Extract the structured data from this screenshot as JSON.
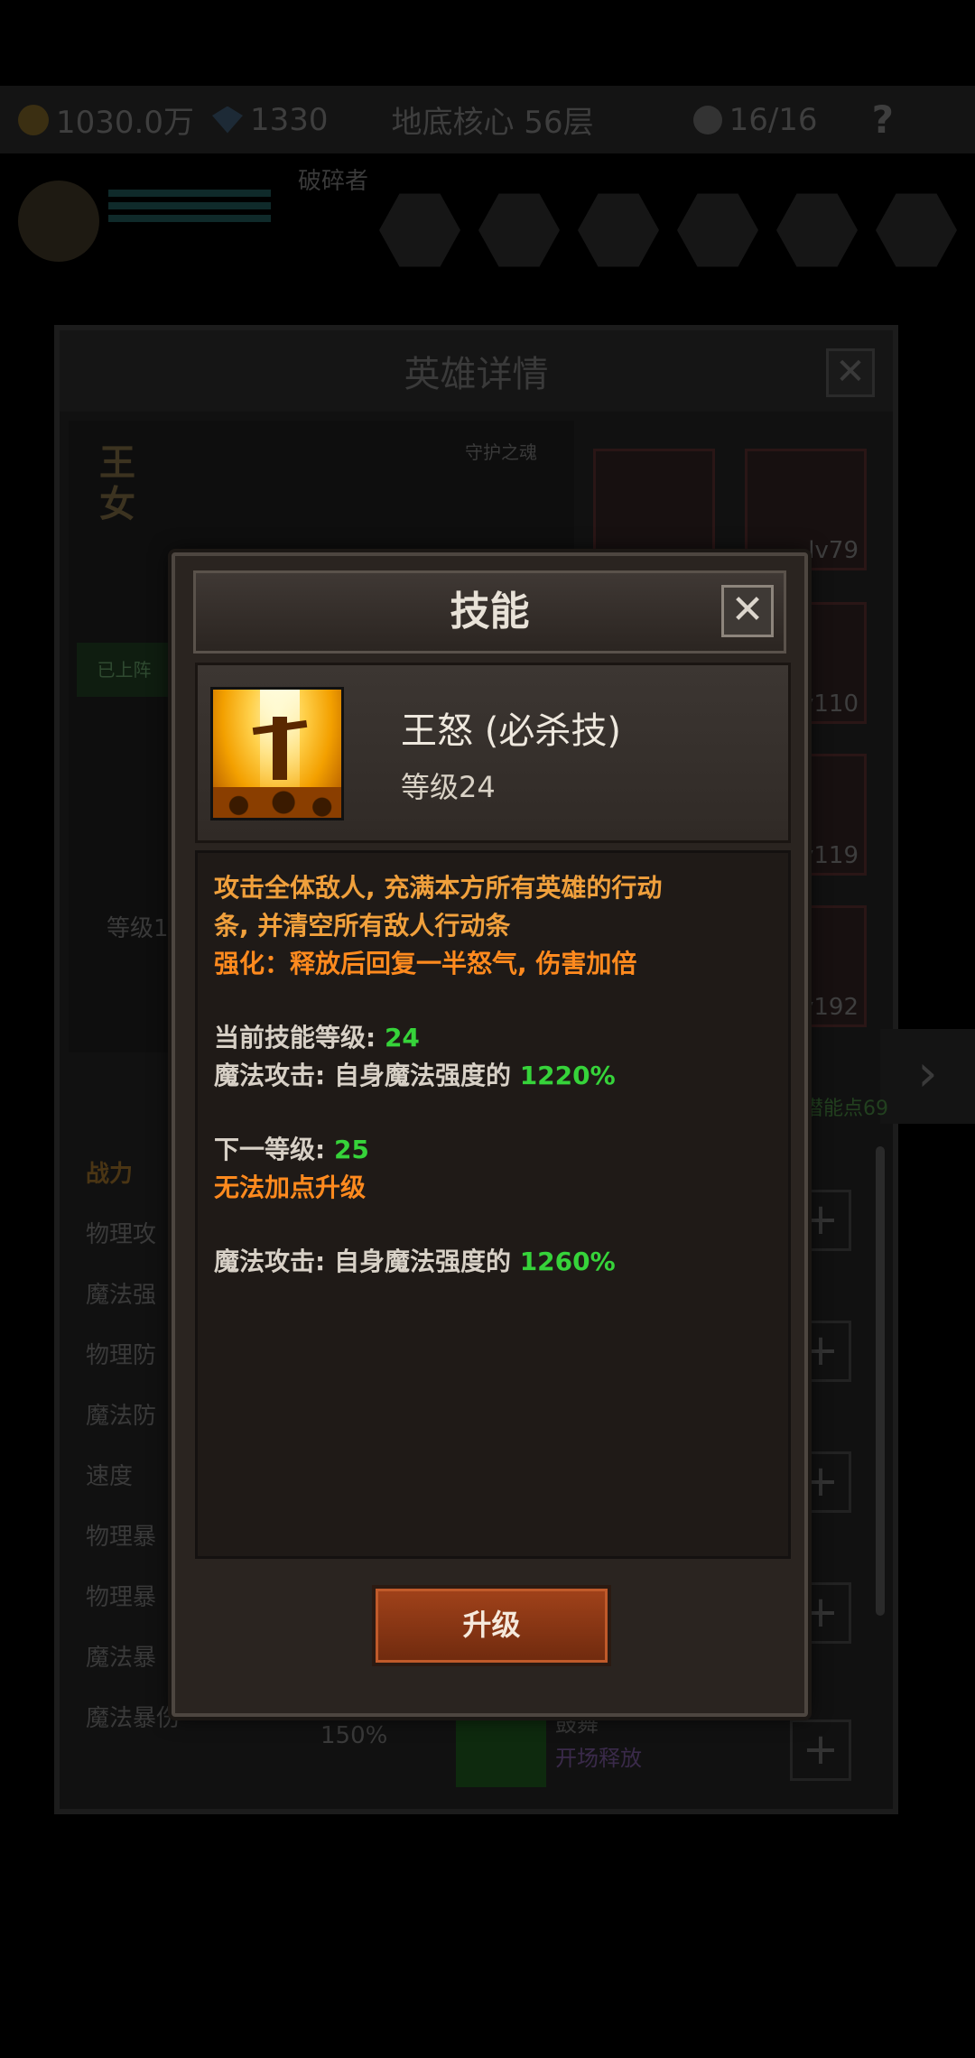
{
  "topbar": {
    "gold": "1030.0万",
    "gems": "1330",
    "location": "地底核心 56层",
    "team_count": "16/16",
    "help": "?"
  },
  "background": {
    "hero_row_label": "破碎者",
    "panel_title": "英雄详情",
    "hero_name": "王女",
    "guardian_soul": "守护之魂",
    "on_team": "已上阵",
    "level_label": "等级1",
    "equip_levels": [
      "lv79",
      "lv110",
      "lv119",
      "lv192"
    ],
    "potential": "潜能点69",
    "stats_header": "战力",
    "stats": [
      "物理攻",
      "魔法强",
      "物理防",
      "魔法防",
      "速度",
      "物理暴",
      "物理暴",
      "魔法暴",
      "魔法暴伤"
    ],
    "magic_crit_dmg_value": "150%",
    "skill_name": "鼓舞",
    "skill_sub": "开场释放",
    "close": "✕",
    "next_arrow": "›",
    "plus": "+"
  },
  "dialog": {
    "title": "技能",
    "close": "✕",
    "skill_name": "王怒 (必杀技)",
    "skill_level": "等级24",
    "desc_line1": "攻击全体敌人, 充满本方所有英雄的行动",
    "desc_line2": "条, 并清空所有敌人行动条",
    "enhance": "强化：释放后回复一半怒气, 伤害加倍",
    "current_level_label": "当前技能等级: ",
    "current_level_value": "24",
    "magic_attack_label": "魔法攻击: 自身魔法强度的 ",
    "magic_attack_current": "1220%",
    "next_level_label": "下一等级: ",
    "next_level_value": "25",
    "cannot_upgrade": "无法加点升级",
    "magic_attack_next_label": "魔法攻击: 自身魔法强度的 ",
    "magic_attack_next": "1260%",
    "upgrade_button": "升级"
  },
  "colors": {
    "desc_orange": "#f0a03c",
    "enhance_orange": "#ff8a1e",
    "value_green": "#36d33a",
    "button_red": "#a1421a"
  }
}
